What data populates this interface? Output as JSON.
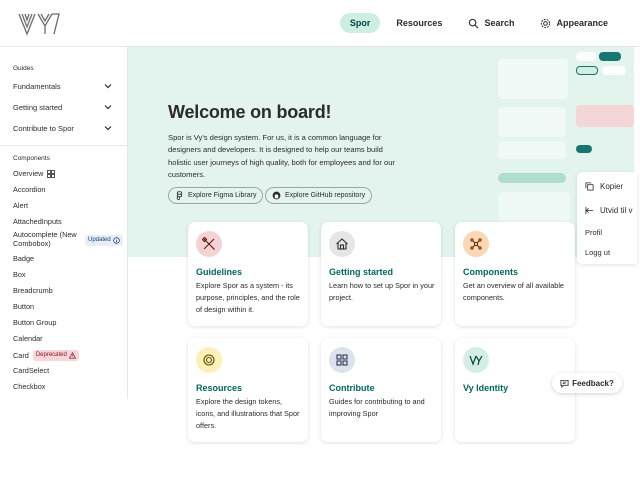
{
  "header": {
    "logo_alt": "Vy",
    "nav": [
      {
        "label": "Spor",
        "active": true
      },
      {
        "label": "Resources",
        "active": false
      },
      {
        "label": "Search",
        "active": false,
        "icon": "search-icon"
      },
      {
        "label": "Appearance",
        "active": false,
        "icon": "gear-icon"
      }
    ]
  },
  "sidebar": {
    "guides_heading": "Guides",
    "guides": [
      {
        "label": "Fundamentals"
      },
      {
        "label": "Getting started"
      },
      {
        "label": "Contribute to Spor"
      }
    ],
    "components_heading": "Components",
    "components": [
      {
        "label": "Overview",
        "icon": "grid-icon"
      },
      {
        "label": "Accordion"
      },
      {
        "label": "Alert"
      },
      {
        "label": "AttachedInputs"
      },
      {
        "label": "Autocomplete (New Combobox)",
        "badge": "Updated"
      },
      {
        "label": "Badge"
      },
      {
        "label": "Box"
      },
      {
        "label": "Breadcrumb"
      },
      {
        "label": "Button"
      },
      {
        "label": "Button Group"
      },
      {
        "label": "Calendar"
      },
      {
        "label": "Card",
        "badge": "Deprecated"
      },
      {
        "label": "CardSelect"
      },
      {
        "label": "Checkbox"
      }
    ]
  },
  "hero": {
    "title": "Welcome on board!",
    "text": "Spor is Vy's design system. For us, it is a common language for designers and developers. It is designed to help our teams build holistic user journeys of high quality, both for employees and for our customers.",
    "figma_button": "Explore Figma Library",
    "github_button": "Explore GitHub repository"
  },
  "cards": [
    {
      "title": "Guidelines",
      "desc": "Explore Spor as a system - its purpose, principles, and the role of design within it.",
      "icon": "design-tools-icon",
      "icon_bg": "#f6d3d3"
    },
    {
      "title": "Getting started",
      "desc": "Learn how to set up Spor in your project.",
      "icon": "home-icon",
      "icon_bg": "#e6e6e6"
    },
    {
      "title": "Components",
      "desc": "Get an overview of all available components.",
      "icon": "components-icon",
      "icon_bg": "#fbd7b4"
    },
    {
      "title": "Resources",
      "desc": "Explore the design tokens, icons, and illustrations that Spor offers.",
      "icon": "resources-icon",
      "icon_bg": "#fbf1b8"
    },
    {
      "title": "Contribute",
      "desc": "Guides for contributing to and improving Spor",
      "icon": "grid-icon",
      "icon_bg": "#dde3ec"
    },
    {
      "title": "Vy Identity",
      "desc": "",
      "icon": "vy-logo-icon",
      "icon_bg": "#d4eee5"
    }
  ],
  "overlay_menu": {
    "items": [
      "Kopier",
      "Utvid til v",
      "Profil",
      "Logg ut"
    ]
  },
  "feedback_label": "Feedback?",
  "colors": {
    "accent": "#00685e",
    "hero_bg": "#e3f3ee",
    "active_nav_bg": "#cfeee3"
  }
}
